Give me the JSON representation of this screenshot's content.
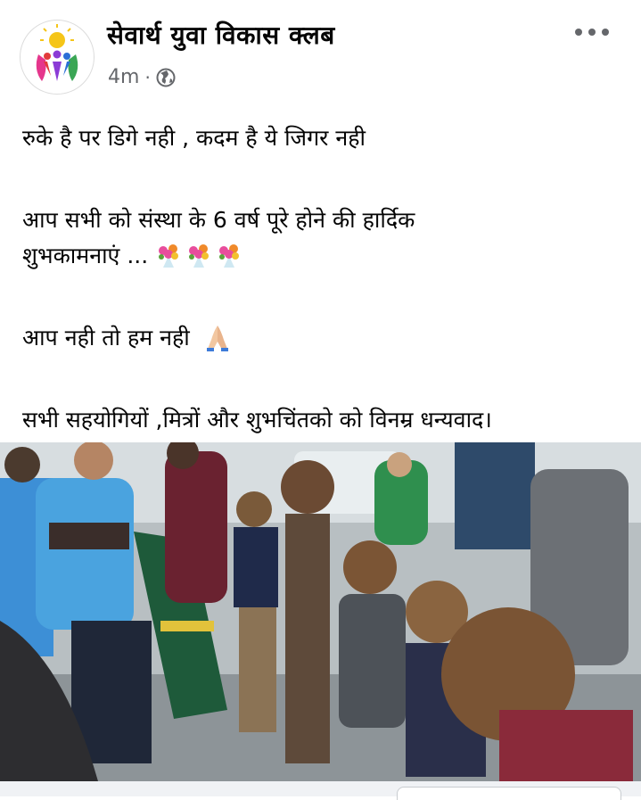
{
  "post": {
    "page_name": "सेवार्थ युवा विकास क्लब",
    "time": "4m",
    "separator": "·",
    "privacy_icon": "globe-icon",
    "more_icon": "more-options-icon",
    "lines": [
      "रुके है पर डिगे नही , कदम है ये जिगर नही",
      "आप सभी को संस्था के 6 वर्ष पूरे  होने की हार्दिक",
      "शुभकामनाएं ...",
      "आप नही तो हम नही",
      "सभी सहयोगियों ,मित्रों और शुभचिंतको को विनम्र धन्यवाद।"
    ],
    "emoji": [
      "bouquet",
      "bouquet",
      "bouquet",
      "folded-hands"
    ]
  },
  "colors": {
    "text": "#050505",
    "meta": "#65676b",
    "background": "#ffffff"
  }
}
